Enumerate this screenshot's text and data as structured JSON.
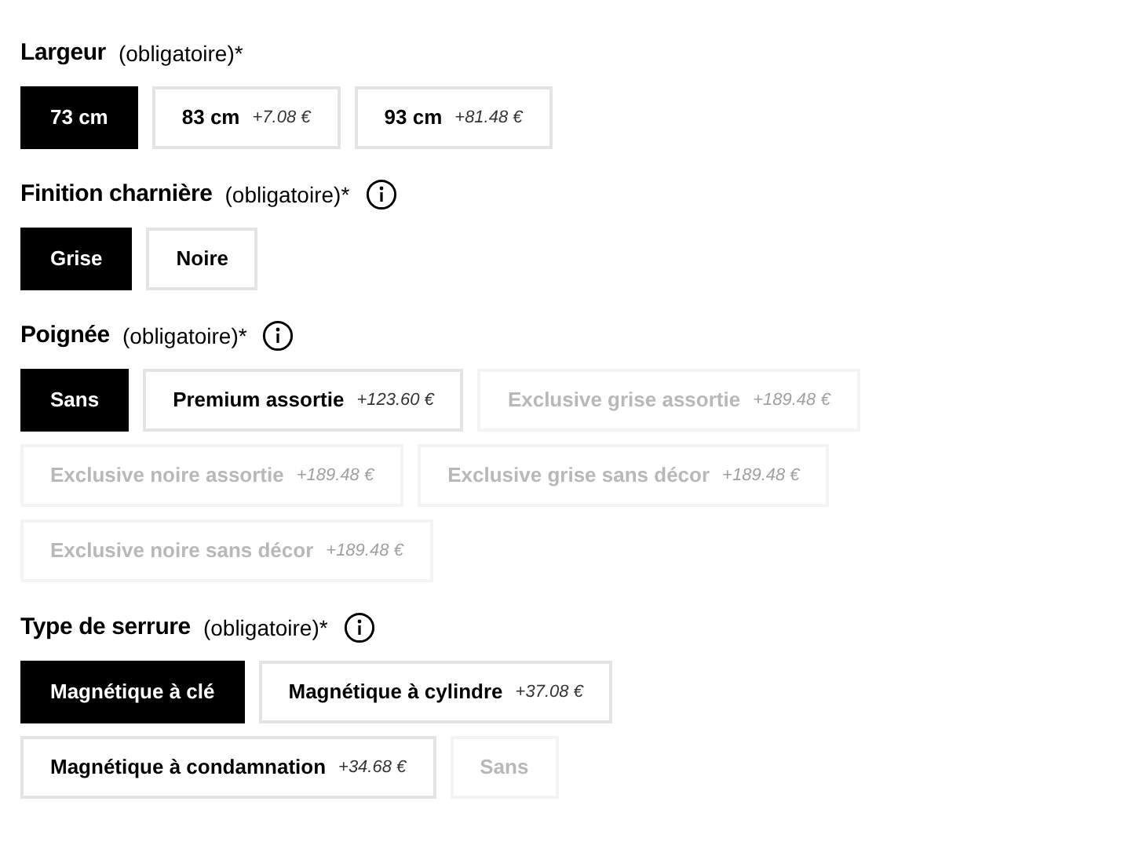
{
  "sections": [
    {
      "title": "Largeur",
      "note": "(obligatoire)*",
      "info": false,
      "options": [
        {
          "label": "73 cm",
          "selected": true,
          "disabled": false
        },
        {
          "label": "83 cm",
          "price": "+7.08 €",
          "selected": false,
          "disabled": false
        },
        {
          "label": "93 cm",
          "price": "+81.48 €",
          "selected": false,
          "disabled": false
        }
      ]
    },
    {
      "title": "Finition charnière",
      "note": "(obligatoire)*",
      "info": true,
      "options": [
        {
          "label": "Grise",
          "selected": true,
          "disabled": false
        },
        {
          "label": "Noire",
          "selected": false,
          "disabled": false
        }
      ]
    },
    {
      "title": "Poignée",
      "note": "(obligatoire)*",
      "info": true,
      "options": [
        {
          "label": "Sans",
          "selected": true,
          "disabled": false
        },
        {
          "label": "Premium assortie",
          "price": "+123.60 €",
          "selected": false,
          "disabled": false
        },
        {
          "label": "Exclusive grise assortie",
          "price": "+189.48 €",
          "selected": false,
          "disabled": true
        },
        {
          "label": "Exclusive noire assortie",
          "price": "+189.48 €",
          "selected": false,
          "disabled": true
        },
        {
          "label": "Exclusive grise sans décor",
          "price": "+189.48 €",
          "selected": false,
          "disabled": true
        },
        {
          "label": "Exclusive noire sans décor",
          "price": "+189.48 €",
          "selected": false,
          "disabled": true
        }
      ]
    },
    {
      "title": "Type de serrure",
      "note": "(obligatoire)*",
      "info": true,
      "options": [
        {
          "label": "Magnétique à clé",
          "selected": true,
          "disabled": false
        },
        {
          "label": "Magnétique à cylindre",
          "price": "+37.08 €",
          "selected": false,
          "disabled": false
        },
        {
          "label": "Magnétique à condamnation",
          "price": "+34.68 €",
          "selected": false,
          "disabled": false
        },
        {
          "label": "Sans",
          "selected": false,
          "disabled": true
        }
      ]
    }
  ]
}
